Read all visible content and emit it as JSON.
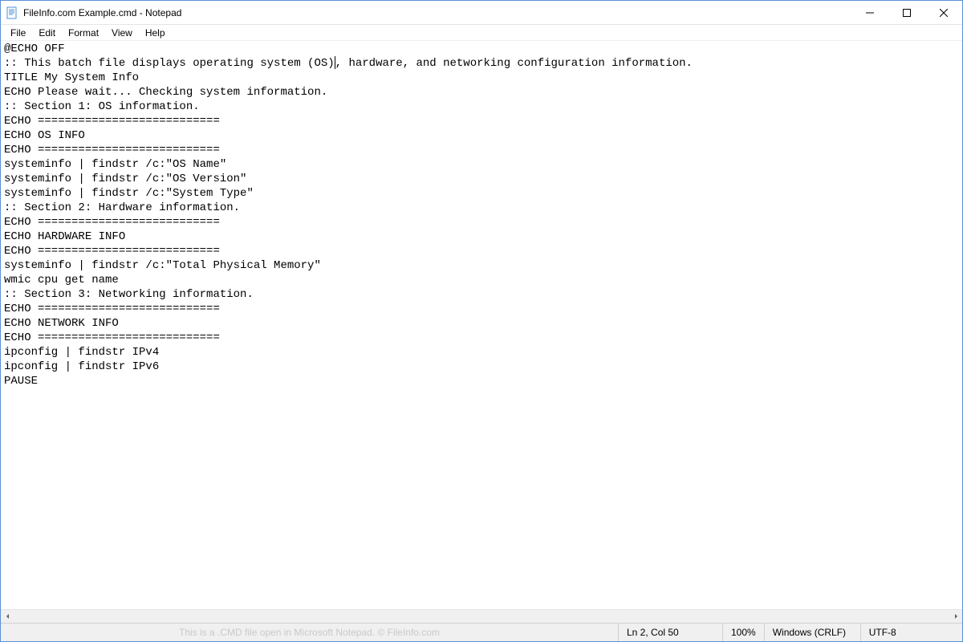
{
  "titlebar": {
    "title": "FileInfo.com Example.cmd - Notepad"
  },
  "menu": {
    "file": "File",
    "edit": "Edit",
    "format": "Format",
    "view": "View",
    "help": "Help"
  },
  "editor": {
    "line1": "@ECHO OFF",
    "line2a": ":: This batch file displays operating system (OS)",
    "line2b": ", hardware, and networking configuration information.",
    "rest": "TITLE My System Info\nECHO Please wait... Checking system information.\n:: Section 1: OS information.\nECHO ===========================\nECHO OS INFO\nECHO ===========================\nsysteminfo | findstr /c:\"OS Name\"\nsysteminfo | findstr /c:\"OS Version\"\nsysteminfo | findstr /c:\"System Type\"\n:: Section 2: Hardware information.\nECHO ===========================\nECHO HARDWARE INFO\nECHO ===========================\nsysteminfo | findstr /c:\"Total Physical Memory\"\nwmic cpu get name\n:: Section 3: Networking information.\nECHO ===========================\nECHO NETWORK INFO\nECHO ===========================\nipconfig | findstr IPv4\nipconfig | findstr IPv6\nPAUSE"
  },
  "statusbar": {
    "watermark": "This is a .CMD file open in Microsoft Notepad. © FileInfo.com",
    "position": "Ln 2, Col 50",
    "zoom": "100%",
    "eol": "Windows (CRLF)",
    "encoding": "UTF-8"
  }
}
